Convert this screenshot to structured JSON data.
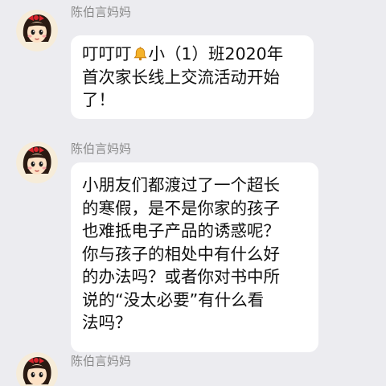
{
  "messages": [
    {
      "sender": "陈伯言妈妈",
      "lines": [
        {
          "before_icon": "叮叮叮",
          "icon": "bell-icon",
          "after_icon": "小（1）班2020年"
        },
        {
          "text": "首次家长线上交流活动开始"
        },
        {
          "text": "了！"
        }
      ]
    },
    {
      "sender": "陈伯言妈妈",
      "lines": [
        {
          "text": "小朋友们都渡过了一个超长"
        },
        {
          "text": "的寒假，是不是你家的孩子"
        },
        {
          "text": "也难抵电子产品的诱惑呢？"
        },
        {
          "text": "你与孩子的相处中有什么好"
        },
        {
          "text": "的办法吗？或者你对书中所"
        },
        {
          "text": "说的“没太必要”有什么看"
        },
        {
          "text": "法吗？"
        }
      ]
    },
    {
      "sender": "陈伯言妈妈"
    }
  ],
  "colors": {
    "background": "#ececf0",
    "bubble": "#ffffff",
    "sender_text": "#8a8a8a",
    "message_text": "#111111"
  }
}
